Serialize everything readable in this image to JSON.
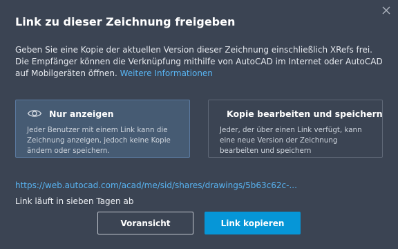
{
  "dialog": {
    "title": "Link zu dieser Zeichnung freigeben",
    "close_icon": "close-icon",
    "description": "Geben Sie eine Kopie der aktuellen Version dieser Zeichnung einschließlich XRefs frei. Die Empfänger können die Verknüpfung mithilfe von AutoCAD im Internet oder AutoCAD auf Mobilgeräten öffnen.",
    "more_info_link": "Weitere Informationen"
  },
  "options": [
    {
      "icon": "eye-icon",
      "title": "Nur anzeigen",
      "text": "Jeder Benutzer mit einem Link kann die Zeichnung anzeigen, jedoch keine Kopie ändern oder speichern.",
      "selected": true
    },
    {
      "icon": "pencil-icon",
      "title": "Kopie bearbeiten und speichern",
      "text": "Jeder, der über einen Link verfügt, kann eine neue Version der Zeichnung bearbeiten und speichern",
      "selected": false
    }
  ],
  "share": {
    "url": "https://web.autocad.com/acad/me/sid/shares/drawings/5b63c62c-...",
    "expiry": "Link läuft in sieben Tagen ab"
  },
  "buttons": {
    "preview": "Voransicht",
    "copy_link": "Link kopieren"
  },
  "colors": {
    "background": "#3b4453",
    "selected_card": "#465b73",
    "link": "#58b4f2",
    "primary": "#0696d7"
  }
}
